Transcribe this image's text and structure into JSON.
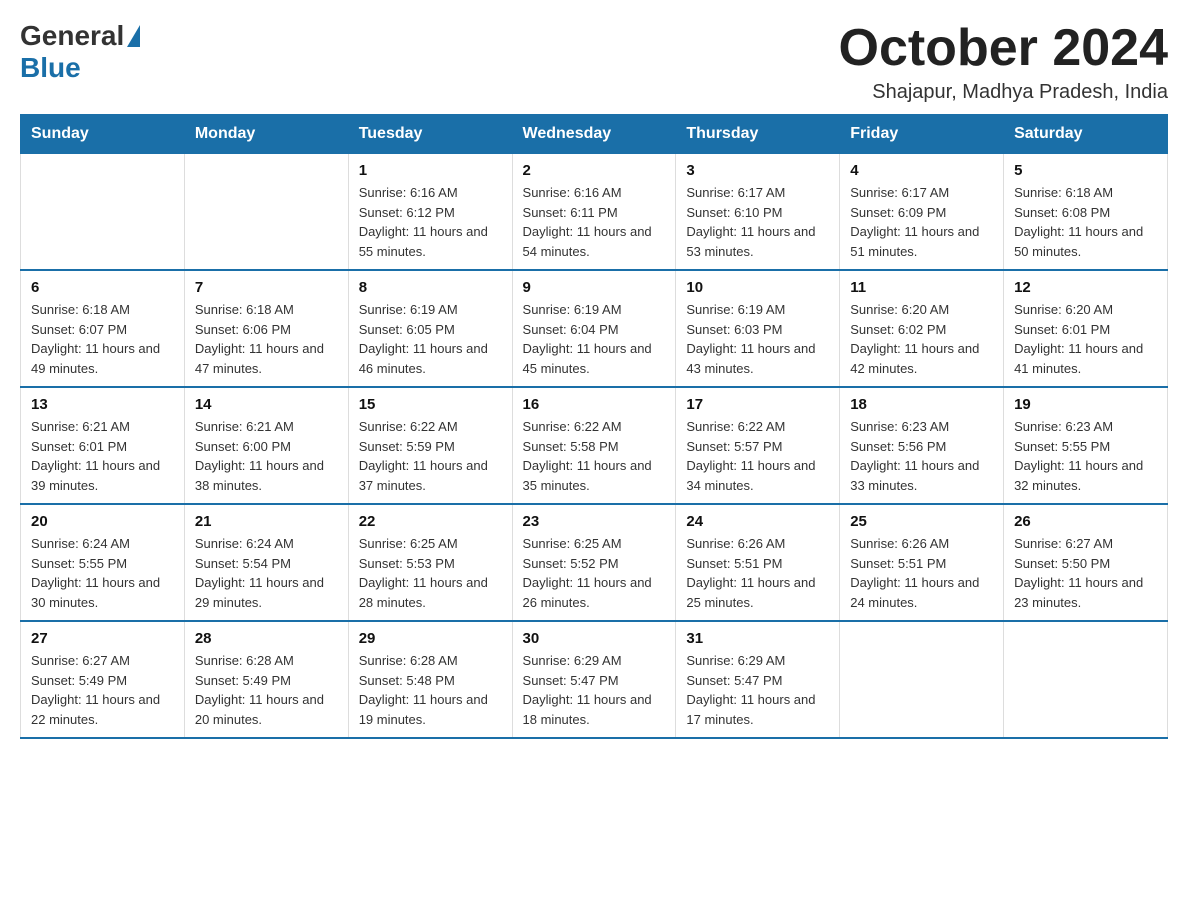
{
  "logo": {
    "general": "General",
    "blue": "Blue"
  },
  "title": "October 2024",
  "location": "Shajapur, Madhya Pradesh, India",
  "days_of_week": [
    "Sunday",
    "Monday",
    "Tuesday",
    "Wednesday",
    "Thursday",
    "Friday",
    "Saturday"
  ],
  "weeks": [
    [
      {
        "day": "",
        "sunrise": "",
        "sunset": "",
        "daylight": ""
      },
      {
        "day": "",
        "sunrise": "",
        "sunset": "",
        "daylight": ""
      },
      {
        "day": "1",
        "sunrise": "Sunrise: 6:16 AM",
        "sunset": "Sunset: 6:12 PM",
        "daylight": "Daylight: 11 hours and 55 minutes."
      },
      {
        "day": "2",
        "sunrise": "Sunrise: 6:16 AM",
        "sunset": "Sunset: 6:11 PM",
        "daylight": "Daylight: 11 hours and 54 minutes."
      },
      {
        "day": "3",
        "sunrise": "Sunrise: 6:17 AM",
        "sunset": "Sunset: 6:10 PM",
        "daylight": "Daylight: 11 hours and 53 minutes."
      },
      {
        "day": "4",
        "sunrise": "Sunrise: 6:17 AM",
        "sunset": "Sunset: 6:09 PM",
        "daylight": "Daylight: 11 hours and 51 minutes."
      },
      {
        "day": "5",
        "sunrise": "Sunrise: 6:18 AM",
        "sunset": "Sunset: 6:08 PM",
        "daylight": "Daylight: 11 hours and 50 minutes."
      }
    ],
    [
      {
        "day": "6",
        "sunrise": "Sunrise: 6:18 AM",
        "sunset": "Sunset: 6:07 PM",
        "daylight": "Daylight: 11 hours and 49 minutes."
      },
      {
        "day": "7",
        "sunrise": "Sunrise: 6:18 AM",
        "sunset": "Sunset: 6:06 PM",
        "daylight": "Daylight: 11 hours and 47 minutes."
      },
      {
        "day": "8",
        "sunrise": "Sunrise: 6:19 AM",
        "sunset": "Sunset: 6:05 PM",
        "daylight": "Daylight: 11 hours and 46 minutes."
      },
      {
        "day": "9",
        "sunrise": "Sunrise: 6:19 AM",
        "sunset": "Sunset: 6:04 PM",
        "daylight": "Daylight: 11 hours and 45 minutes."
      },
      {
        "day": "10",
        "sunrise": "Sunrise: 6:19 AM",
        "sunset": "Sunset: 6:03 PM",
        "daylight": "Daylight: 11 hours and 43 minutes."
      },
      {
        "day": "11",
        "sunrise": "Sunrise: 6:20 AM",
        "sunset": "Sunset: 6:02 PM",
        "daylight": "Daylight: 11 hours and 42 minutes."
      },
      {
        "day": "12",
        "sunrise": "Sunrise: 6:20 AM",
        "sunset": "Sunset: 6:01 PM",
        "daylight": "Daylight: 11 hours and 41 minutes."
      }
    ],
    [
      {
        "day": "13",
        "sunrise": "Sunrise: 6:21 AM",
        "sunset": "Sunset: 6:01 PM",
        "daylight": "Daylight: 11 hours and 39 minutes."
      },
      {
        "day": "14",
        "sunrise": "Sunrise: 6:21 AM",
        "sunset": "Sunset: 6:00 PM",
        "daylight": "Daylight: 11 hours and 38 minutes."
      },
      {
        "day": "15",
        "sunrise": "Sunrise: 6:22 AM",
        "sunset": "Sunset: 5:59 PM",
        "daylight": "Daylight: 11 hours and 37 minutes."
      },
      {
        "day": "16",
        "sunrise": "Sunrise: 6:22 AM",
        "sunset": "Sunset: 5:58 PM",
        "daylight": "Daylight: 11 hours and 35 minutes."
      },
      {
        "day": "17",
        "sunrise": "Sunrise: 6:22 AM",
        "sunset": "Sunset: 5:57 PM",
        "daylight": "Daylight: 11 hours and 34 minutes."
      },
      {
        "day": "18",
        "sunrise": "Sunrise: 6:23 AM",
        "sunset": "Sunset: 5:56 PM",
        "daylight": "Daylight: 11 hours and 33 minutes."
      },
      {
        "day": "19",
        "sunrise": "Sunrise: 6:23 AM",
        "sunset": "Sunset: 5:55 PM",
        "daylight": "Daylight: 11 hours and 32 minutes."
      }
    ],
    [
      {
        "day": "20",
        "sunrise": "Sunrise: 6:24 AM",
        "sunset": "Sunset: 5:55 PM",
        "daylight": "Daylight: 11 hours and 30 minutes."
      },
      {
        "day": "21",
        "sunrise": "Sunrise: 6:24 AM",
        "sunset": "Sunset: 5:54 PM",
        "daylight": "Daylight: 11 hours and 29 minutes."
      },
      {
        "day": "22",
        "sunrise": "Sunrise: 6:25 AM",
        "sunset": "Sunset: 5:53 PM",
        "daylight": "Daylight: 11 hours and 28 minutes."
      },
      {
        "day": "23",
        "sunrise": "Sunrise: 6:25 AM",
        "sunset": "Sunset: 5:52 PM",
        "daylight": "Daylight: 11 hours and 26 minutes."
      },
      {
        "day": "24",
        "sunrise": "Sunrise: 6:26 AM",
        "sunset": "Sunset: 5:51 PM",
        "daylight": "Daylight: 11 hours and 25 minutes."
      },
      {
        "day": "25",
        "sunrise": "Sunrise: 6:26 AM",
        "sunset": "Sunset: 5:51 PM",
        "daylight": "Daylight: 11 hours and 24 minutes."
      },
      {
        "day": "26",
        "sunrise": "Sunrise: 6:27 AM",
        "sunset": "Sunset: 5:50 PM",
        "daylight": "Daylight: 11 hours and 23 minutes."
      }
    ],
    [
      {
        "day": "27",
        "sunrise": "Sunrise: 6:27 AM",
        "sunset": "Sunset: 5:49 PM",
        "daylight": "Daylight: 11 hours and 22 minutes."
      },
      {
        "day": "28",
        "sunrise": "Sunrise: 6:28 AM",
        "sunset": "Sunset: 5:49 PM",
        "daylight": "Daylight: 11 hours and 20 minutes."
      },
      {
        "day": "29",
        "sunrise": "Sunrise: 6:28 AM",
        "sunset": "Sunset: 5:48 PM",
        "daylight": "Daylight: 11 hours and 19 minutes."
      },
      {
        "day": "30",
        "sunrise": "Sunrise: 6:29 AM",
        "sunset": "Sunset: 5:47 PM",
        "daylight": "Daylight: 11 hours and 18 minutes."
      },
      {
        "day": "31",
        "sunrise": "Sunrise: 6:29 AM",
        "sunset": "Sunset: 5:47 PM",
        "daylight": "Daylight: 11 hours and 17 minutes."
      },
      {
        "day": "",
        "sunrise": "",
        "sunset": "",
        "daylight": ""
      },
      {
        "day": "",
        "sunrise": "",
        "sunset": "",
        "daylight": ""
      }
    ]
  ]
}
